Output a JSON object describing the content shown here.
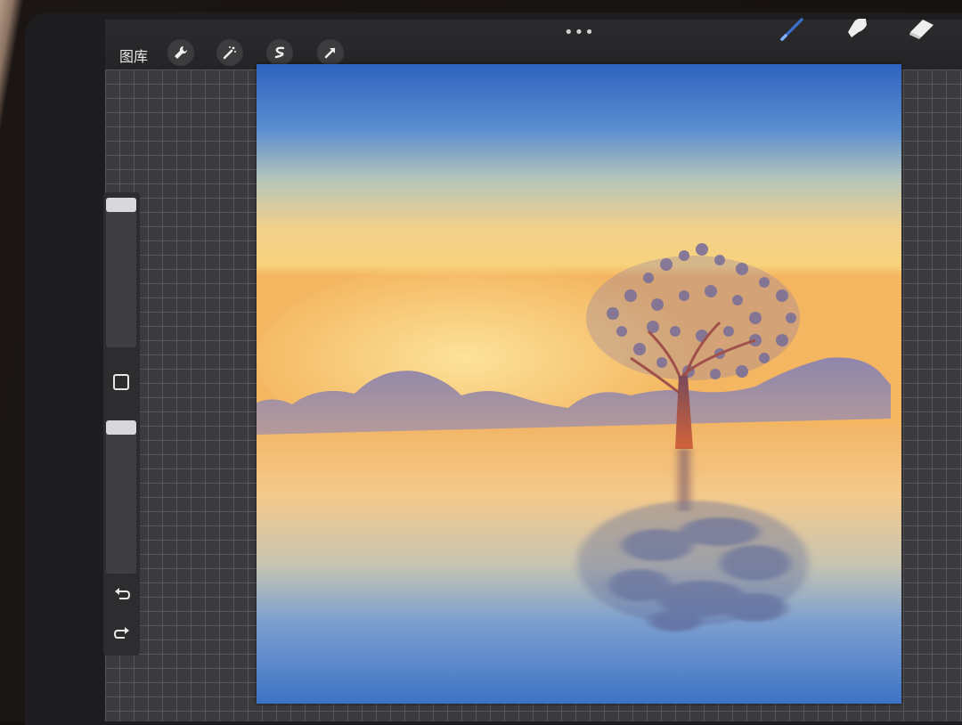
{
  "toolbar": {
    "gallery_label": "图库",
    "menu_dots": "•••",
    "left_tools": [
      {
        "icon": "wrench-icon"
      },
      {
        "icon": "magic-wand-icon"
      },
      {
        "icon": "selection-s-icon"
      },
      {
        "icon": "arrow-transform-icon"
      }
    ],
    "right_tools": [
      {
        "icon": "brush-icon",
        "active": true
      },
      {
        "icon": "smudge-icon"
      },
      {
        "icon": "eraser-icon"
      }
    ],
    "active_color": "#3a6fd0"
  },
  "sidebar": {
    "brush_size_level": 0.0,
    "opacity_level": 0.0,
    "modify_icon": "square-icon",
    "undo_icon": "undo-icon",
    "redo_icon": "redo-icon"
  },
  "canvas": {
    "subject": "sunset-lake-tree-painting",
    "colors": {
      "sky_top": "#2f6fc4",
      "horizon_glow": "#f7d07a",
      "water_bottom": "#3f77c9",
      "mountains": "#8a7fa0",
      "tree": "#c0603a"
    }
  }
}
